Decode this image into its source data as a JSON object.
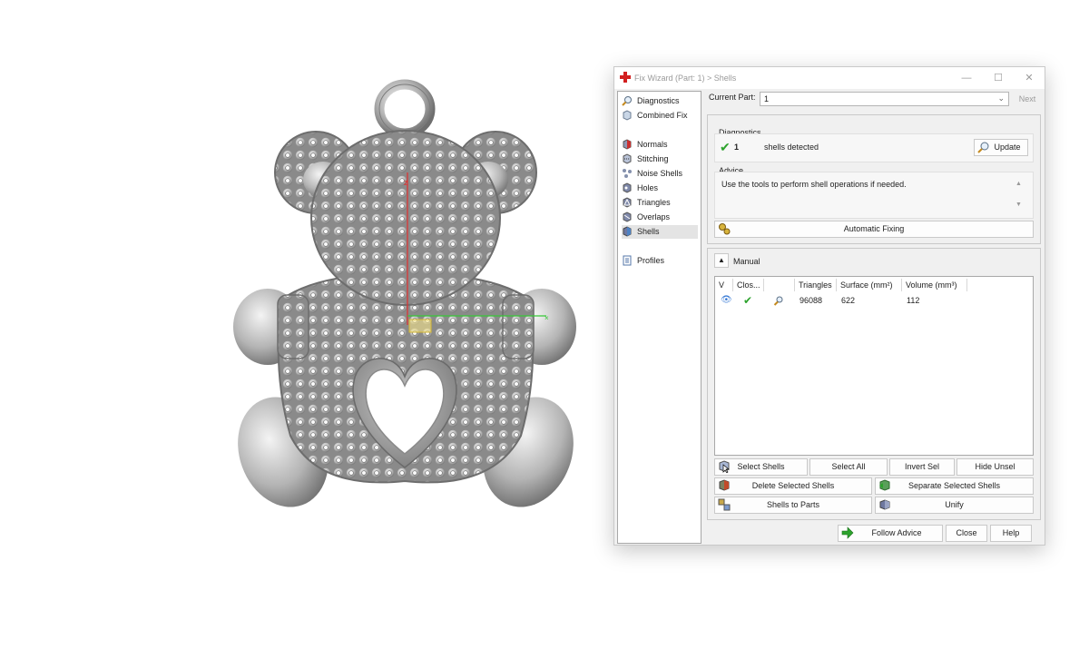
{
  "window": {
    "title": "Fix Wizard (Part: 1) > Shells",
    "buttons": {
      "minimize": "—",
      "maximize": "☐",
      "close": "✕"
    }
  },
  "nav": {
    "items": [
      {
        "label": "Diagnostics",
        "icon": "magnifier-icon"
      },
      {
        "label": "Combined Fix",
        "icon": "cube-icon"
      },
      {
        "label": "Normals",
        "icon": "cube-red-icon"
      },
      {
        "label": "Stitching",
        "icon": "cube-stitch-icon"
      },
      {
        "label": "Noise Shells",
        "icon": "noise-shells-icon"
      },
      {
        "label": "Holes",
        "icon": "cube-holes-icon"
      },
      {
        "label": "Triangles",
        "icon": "cube-triangles-icon"
      },
      {
        "label": "Overlaps",
        "icon": "cube-overlaps-icon"
      },
      {
        "label": "Shells",
        "icon": "cube-shells-icon"
      },
      {
        "label": "Profiles",
        "icon": "document-icon"
      }
    ],
    "selected": "Shells"
  },
  "current_part": {
    "label": "Current Part:",
    "value": "1",
    "next": "Next"
  },
  "diagnostics": {
    "title": "Diagnostics",
    "count": "1",
    "message": "shells detected",
    "update": "Update"
  },
  "advice": {
    "title": "Advice",
    "text": "Use the tools to perform shell operations if needed.",
    "scroll_up": "▲",
    "scroll_down": "▼"
  },
  "automatic_fixing": "Automatic Fixing",
  "manual": {
    "title": "Manual",
    "collapse": "▲",
    "columns": [
      "V",
      "Clos...",
      "",
      "Triangles",
      "Surface (mm²)",
      "Volume (mm³)"
    ],
    "rows": [
      {
        "triangles": "96088",
        "surface": "622",
        "volume": "112"
      }
    ],
    "buttons": {
      "select_shells": "Select Shells",
      "select_all": "Select All",
      "invert_sel": "Invert Sel",
      "hide_unsel": "Hide Unsel",
      "delete_selected": "Delete Selected Shells",
      "separate_selected": "Separate Selected Shells",
      "shells_to_parts": "Shells to Parts",
      "unify": "Unify"
    }
  },
  "footer": {
    "follow_advice": "Follow Advice",
    "close": "Close",
    "help": "Help"
  },
  "colors": {
    "accent_green": "#2da32d",
    "axis_red": "#e03030",
    "model_grey": "#b8b8b8"
  }
}
